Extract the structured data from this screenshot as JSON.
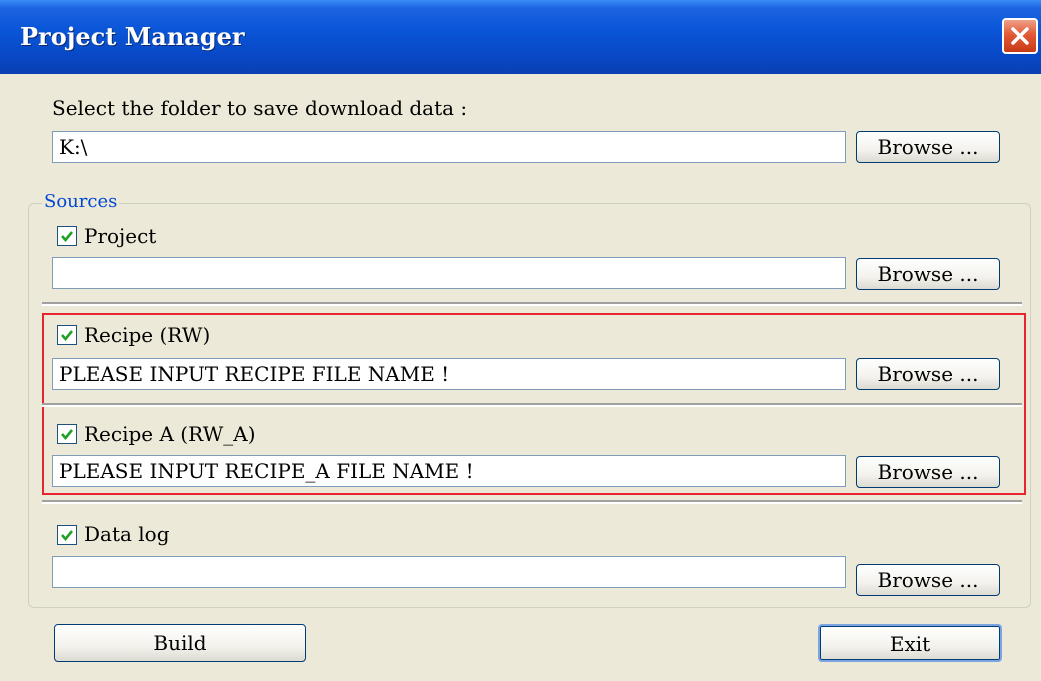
{
  "window": {
    "title": "Project Manager"
  },
  "folder": {
    "prompt": "Select the folder to save download data  :",
    "value": "K:\\",
    "browse_label": "Browse ..."
  },
  "sources": {
    "legend": "Sources",
    "items": [
      {
        "label": "Project",
        "checked": true,
        "value": "",
        "browse_label": "Browse ..."
      },
      {
        "label": "Recipe (RW)",
        "checked": true,
        "value": "PLEASE INPUT RECIPE FILE NAME !",
        "browse_label": "Browse ..."
      },
      {
        "label": "Recipe A (RW_A)",
        "checked": true,
        "value": "PLEASE INPUT RECIPE_A FILE NAME !",
        "browse_label": "Browse ..."
      },
      {
        "label": "Data log",
        "checked": true,
        "value": "",
        "browse_label": "Browse ..."
      }
    ]
  },
  "actions": {
    "build_label": "Build",
    "exit_label": "Exit"
  },
  "colors": {
    "titlebar": "#0a56d8",
    "highlight": "#e8242c",
    "check": "#21a121",
    "legend": "#0046d5"
  }
}
